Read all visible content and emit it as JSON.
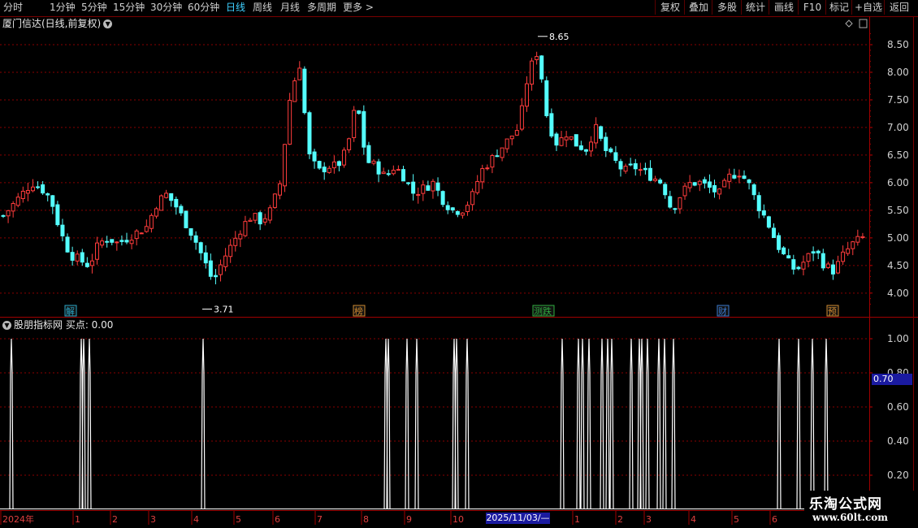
{
  "toolbar": {
    "periods": [
      "分时",
      "1分钟",
      "5分钟",
      "15分钟",
      "30分钟",
      "60分钟",
      "日线",
      "周线",
      "月线",
      "多周期",
      "更多 >"
    ],
    "active_period": "日线",
    "buttons": [
      "复权",
      "叠加",
      "多股",
      "统计",
      "画线",
      "F10",
      "标记",
      "+自选",
      "返回"
    ]
  },
  "main_chart": {
    "title": "厦门信达(日线,前复权)",
    "high_label": "8.65",
    "low_label": "3.71",
    "y_ticks": [
      "8.50",
      "8.00",
      "7.50",
      "7.00",
      "6.50",
      "6.00",
      "5.50",
      "5.00",
      "4.50",
      "4.00"
    ],
    "event_markers": [
      "解",
      "榜",
      "测跌",
      "财",
      "预"
    ]
  },
  "sub_chart": {
    "title": "股朋指标网  买点: 0.00",
    "y_ticks": [
      "1.00",
      "0.80",
      "0.60",
      "0.40",
      "0.20"
    ],
    "value_label": "0.70"
  },
  "time_axis": {
    "labels": [
      "2024年",
      "1",
      "2",
      "3",
      "4",
      "5",
      "6",
      "7",
      "8",
      "9",
      "10",
      "1",
      "2",
      "3",
      "4",
      "5",
      "6"
    ],
    "cursor_date": "2025/11/03/—"
  },
  "watermark": {
    "line1": "乐淘公式网",
    "line2": "www.60lt.com"
  },
  "colors": {
    "up": "#ff3c3c",
    "down": "#54ffff",
    "grid": "#8a0000",
    "signal": "#ffffff",
    "active": "#3fd0ff"
  },
  "chart_data": [
    {
      "type": "candlestick",
      "title": "厦门信达(日线,前复权)",
      "x_labels": [
        "2024年",
        "1",
        "2",
        "3",
        "4",
        "5",
        "6",
        "7",
        "8",
        "9",
        "10",
        "1",
        "2",
        "3",
        "4",
        "5",
        "6"
      ],
      "ylim": [
        3.6,
        8.75
      ],
      "y_ticks": [
        4.0,
        4.5,
        5.0,
        5.5,
        6.0,
        6.5,
        7.0,
        7.5,
        8.0,
        8.5
      ],
      "annotations": [
        {
          "label": "8.65",
          "value": 8.65
        },
        {
          "label": "3.71",
          "value": 3.71
        }
      ],
      "close_trend": [
        5.4,
        5.6,
        5.8,
        6.0,
        5.9,
        5.7,
        5.1,
        4.7,
        4.6,
        4.5,
        4.9,
        5.0,
        4.9,
        5.0,
        5.1,
        5.2,
        5.6,
        5.8,
        5.6,
        5.3,
        5.0,
        4.6,
        4.2,
        4.6,
        4.9,
        5.2,
        5.4,
        5.3,
        5.5,
        6.0,
        7.5,
        8.2,
        6.5,
        6.2,
        6.3,
        6.3,
        6.6,
        7.5,
        6.4,
        6.3,
        6.1,
        6.3,
        6.1,
        5.8,
        5.9,
        6.0,
        5.7,
        5.5,
        5.5,
        5.7,
        6.2,
        6.4,
        6.6,
        6.8,
        7.0,
        8.0,
        8.4,
        7.1,
        6.7,
        6.9,
        6.7,
        6.6,
        7.0,
        6.6,
        6.4,
        6.2,
        6.3,
        6.2,
        6.1,
        6.0,
        5.5,
        5.8,
        6.0,
        6.0,
        5.9,
        5.8,
        6.1,
        6.2,
        6.0,
        5.6,
        5.3,
        4.9,
        4.6,
        4.4,
        4.6,
        4.8,
        4.5,
        4.4,
        4.7,
        4.9,
        5.0
      ]
    },
    {
      "type": "bar",
      "title": "股朋指标网",
      "ylim": [
        0,
        1.1
      ],
      "y_ticks": [
        0.2,
        0.4,
        0.6,
        0.8,
        1.0
      ],
      "signal_label": "买点",
      "signal_value": 0.0,
      "signal_count": 30
    }
  ]
}
